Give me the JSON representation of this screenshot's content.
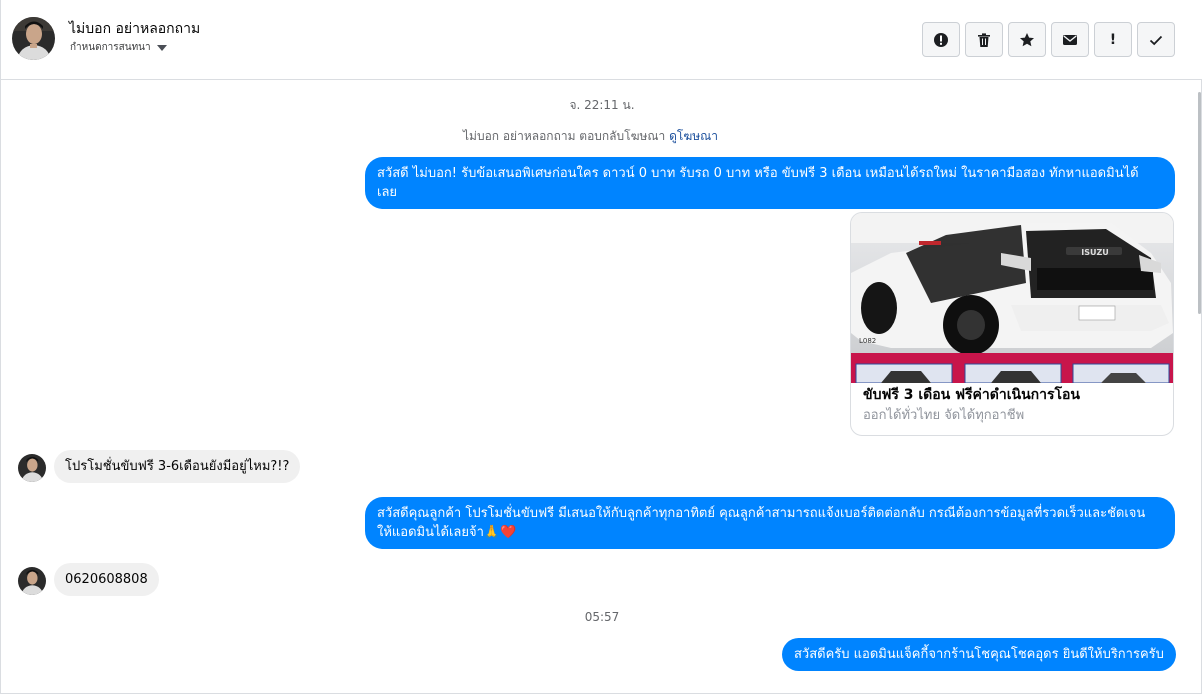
{
  "header": {
    "name": "ไม่บอก อย่าหลอกถาม",
    "status": "กำหนดการสนทนา"
  },
  "toolbar": {
    "buttons": [
      "info-icon",
      "trash-icon",
      "star-icon",
      "mail-icon",
      "exclamation-icon",
      "check-icon"
    ],
    "exclamation": "!"
  },
  "thread": {
    "timestamp_1": "จ. 22:11 น.",
    "ad_note_text": "ไม่บอก อย่าหลอกถาม ตอบกลับโฆษณา",
    "ad_note_link": "ดูโฆษณา",
    "msg_1_line1": "สวัสดี ไม่บอก! รับข้อเสนอพิเศษก่อนใคร ดาวน์ 0 บาท รับรถ 0 บาท หรือ ขับฟรี 3 เดือน เหมือนได้รถใหม่ ในราคามือสอง ทักหาแอดมินได้",
    "msg_1_line2": "เลย",
    "ad_card": {
      "image_plate": "L082",
      "image_brand": "ISUZU",
      "title": "ขับฟรี 3 เดือน ฟรีค่าดำเนินการโอน",
      "subtitle": "ออกได้ทั่วไทย จัดได้ทุกอาชีพ"
    },
    "msg_2": "โปรโมชั่นขับฟรี 3-6เดือนยังมีอยู่ไหม?!?",
    "msg_3_line1": "สวัสดีคุณลูกค้า โปรโมชั่นขับฟรี มีเสนอให้กับลูกค้าทุกอาทิตย์ คุณลูกค้าสามารถแจ้งเบอร์ติดต่อกลับ กรณีต้องการข้อมูลที่รวดเร็วและชัดเจน",
    "msg_3_line2": "ให้แอดมินได้เลยจ้า🙏❤️",
    "msg_4": "0620608808",
    "timestamp_2": "05:57",
    "msg_5": "สวัสดีครับ แอดมินแจ็คกี้จากร้านโชคุณโชคอุดร ยินดีให้บริการครับ"
  },
  "colors": {
    "outgoing_bubble": "#0084ff",
    "incoming_bubble": "#f0f0f0",
    "link": "#1b4f9c"
  }
}
